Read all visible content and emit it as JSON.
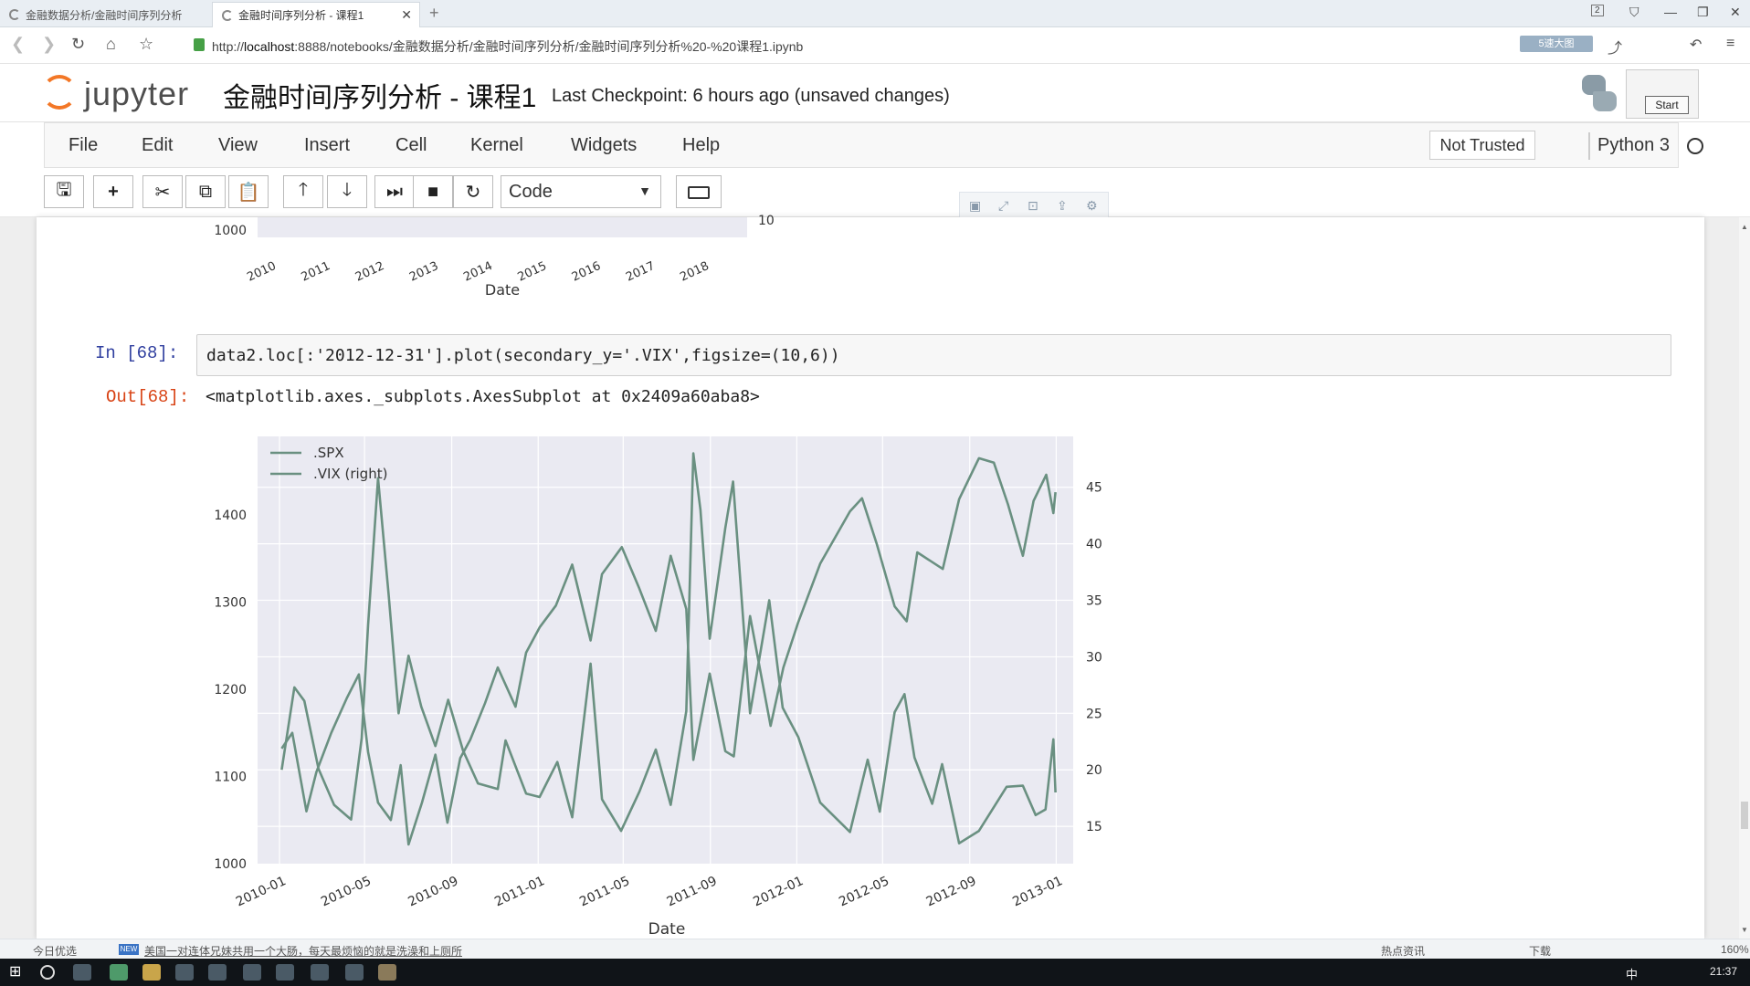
{
  "browser": {
    "tabs": [
      {
        "title": "金融数据分析/金融时间序列分析"
      },
      {
        "title": "金融时间序列分析 - 课程1"
      }
    ],
    "url_scheme": "http://",
    "url_host": "localhost",
    "url_rest": ":8888/notebooks/金融数据分析/金融时间序列分析/金融时间序列分析%20-%20课程1.ipynb",
    "tab_badge": "2",
    "zoom_badge": "5速大图"
  },
  "jupyter": {
    "logo_text": "jupyter",
    "notebook_title": "金融时间序列分析 - 课程1",
    "checkpoint": "Last Checkpoint: 6 hours ago (unsaved changes)",
    "start_button": "Start",
    "menu": [
      "File",
      "Edit",
      "View",
      "Insert",
      "Cell",
      "Kernel",
      "Widgets",
      "Help"
    ],
    "trust": "Not Trusted",
    "kernel": "Python 3",
    "cell_type": "Code"
  },
  "cells": {
    "in_prompt": "In  [68]:",
    "code": "data2.loc[:'2012-12-31'].plot(secondary_y='.VIX',figsize=(10,6))",
    "out_prompt": "Out[68]:",
    "out_text": "<matplotlib.axes._subplots.AxesSubplot at 0x2409a60aba8>"
  },
  "prev_chart": {
    "x_ticks": [
      "2010",
      "2011",
      "2012",
      "2013",
      "2014",
      "2015",
      "2016",
      "2017",
      "2018"
    ],
    "y_tick": "1000",
    "right_tick": "10",
    "xlabel": "Date"
  },
  "chart_data": {
    "type": "line",
    "xlabel": "Date",
    "ylabel": "",
    "x_range": [
      "2009-12-01",
      "2013-01-25"
    ],
    "x_ticks": [
      "2010-01",
      "2010-05",
      "2010-09",
      "2011-01",
      "2011-05",
      "2011-09",
      "2012-01",
      "2012-05",
      "2012-09",
      "2013-01"
    ],
    "ylim_left": [
      1000,
      1490
    ],
    "yticks_left": [
      1000,
      1100,
      1200,
      1300,
      1400
    ],
    "ylim_right": [
      11.7,
      49.5
    ],
    "yticks_right": [
      15,
      20,
      25,
      30,
      35,
      40,
      45
    ],
    "legend_position": "top-left",
    "grid": true,
    "line_color": "#6a9081",
    "series": [
      {
        "name": ".SPX",
        "axis": "left",
        "points": [
          [
            "2010-01-04",
            1132
          ],
          [
            "2010-01-19",
            1150
          ],
          [
            "2010-02-08",
            1060
          ],
          [
            "2010-02-22",
            1105
          ],
          [
            "2010-03-15",
            1150
          ],
          [
            "2010-04-06",
            1190
          ],
          [
            "2010-04-23",
            1217
          ],
          [
            "2010-05-06",
            1128
          ],
          [
            "2010-05-20",
            1070
          ],
          [
            "2010-06-07",
            1050
          ],
          [
            "2010-06-21",
            1113
          ],
          [
            "2010-07-02",
            1022
          ],
          [
            "2010-07-21",
            1070
          ],
          [
            "2010-08-09",
            1125
          ],
          [
            "2010-08-26",
            1047
          ],
          [
            "2010-09-13",
            1121
          ],
          [
            "2010-09-27",
            1142
          ],
          [
            "2010-10-18",
            1184
          ],
          [
            "2010-11-05",
            1225
          ],
          [
            "2010-11-30",
            1180
          ],
          [
            "2010-12-15",
            1242
          ],
          [
            "2011-01-03",
            1271
          ],
          [
            "2011-01-26",
            1296
          ],
          [
            "2011-02-18",
            1343
          ],
          [
            "2011-03-16",
            1256
          ],
          [
            "2011-04-01",
            1332
          ],
          [
            "2011-04-29",
            1363
          ],
          [
            "2011-05-23",
            1317
          ],
          [
            "2011-06-16",
            1267
          ],
          [
            "2011-07-07",
            1353
          ],
          [
            "2011-07-29",
            1292
          ],
          [
            "2011-08-08",
            1119
          ],
          [
            "2011-08-31",
            1218
          ],
          [
            "2011-09-22",
            1129
          ],
          [
            "2011-10-04",
            1123
          ],
          [
            "2011-10-27",
            1284
          ],
          [
            "2011-11-25",
            1158
          ],
          [
            "2011-12-13",
            1225
          ],
          [
            "2012-01-03",
            1277
          ],
          [
            "2012-02-03",
            1344
          ],
          [
            "2012-03-16",
            1404
          ],
          [
            "2012-04-02",
            1419
          ],
          [
            "2012-04-23",
            1366
          ],
          [
            "2012-05-18",
            1295
          ],
          [
            "2012-06-04",
            1278
          ],
          [
            "2012-06-19",
            1357
          ],
          [
            "2012-07-25",
            1338
          ],
          [
            "2012-08-17",
            1418
          ],
          [
            "2012-09-14",
            1465
          ],
          [
            "2012-10-05",
            1460
          ],
          [
            "2012-10-25",
            1412
          ],
          [
            "2012-11-15",
            1353
          ],
          [
            "2012-11-30",
            1416
          ],
          [
            "2012-12-18",
            1446
          ],
          [
            "2012-12-28",
            1402
          ],
          [
            "2012-12-31",
            1426
          ]
        ]
      },
      {
        "name": ".VIX (right)",
        "axis": "right",
        "points": [
          [
            "2010-01-04",
            20.0
          ],
          [
            "2010-01-22",
            27.3
          ],
          [
            "2010-02-05",
            26.1
          ],
          [
            "2010-02-25",
            20.1
          ],
          [
            "2010-03-19",
            16.9
          ],
          [
            "2010-04-12",
            15.6
          ],
          [
            "2010-04-27",
            22.8
          ],
          [
            "2010-05-06",
            32.8
          ],
          [
            "2010-05-20",
            45.8
          ],
          [
            "2010-06-04",
            35.5
          ],
          [
            "2010-06-18",
            25.0
          ],
          [
            "2010-07-02",
            30.1
          ],
          [
            "2010-07-20",
            25.6
          ],
          [
            "2010-08-09",
            22.1
          ],
          [
            "2010-08-27",
            26.2
          ],
          [
            "2010-09-17",
            21.7
          ],
          [
            "2010-10-08",
            18.8
          ],
          [
            "2010-11-05",
            18.3
          ],
          [
            "2010-11-16",
            22.6
          ],
          [
            "2010-12-15",
            17.9
          ],
          [
            "2011-01-03",
            17.6
          ],
          [
            "2011-01-28",
            20.7
          ],
          [
            "2011-02-18",
            15.8
          ],
          [
            "2011-03-16",
            29.4
          ],
          [
            "2011-04-01",
            17.4
          ],
          [
            "2011-04-28",
            14.6
          ],
          [
            "2011-05-24",
            18.1
          ],
          [
            "2011-06-16",
            21.8
          ],
          [
            "2011-07-07",
            16.9
          ],
          [
            "2011-07-29",
            25.2
          ],
          [
            "2011-08-08",
            48.0
          ],
          [
            "2011-08-18",
            43.0
          ],
          [
            "2011-08-31",
            31.6
          ],
          [
            "2011-09-22",
            41.4
          ],
          [
            "2011-10-03",
            45.5
          ],
          [
            "2011-10-27",
            25.0
          ],
          [
            "2011-11-23",
            35.0
          ],
          [
            "2011-12-12",
            25.5
          ],
          [
            "2012-01-03",
            22.9
          ],
          [
            "2012-02-03",
            17.1
          ],
          [
            "2012-03-16",
            14.5
          ],
          [
            "2012-04-10",
            20.9
          ],
          [
            "2012-04-27",
            16.3
          ],
          [
            "2012-05-18",
            25.1
          ],
          [
            "2012-06-01",
            26.7
          ],
          [
            "2012-06-15",
            21.1
          ],
          [
            "2012-07-10",
            17.0
          ],
          [
            "2012-07-24",
            20.5
          ],
          [
            "2012-08-17",
            13.5
          ],
          [
            "2012-09-14",
            14.6
          ],
          [
            "2012-10-23",
            18.5
          ],
          [
            "2012-11-15",
            18.6
          ],
          [
            "2012-12-03",
            16.0
          ],
          [
            "2012-12-17",
            16.5
          ],
          [
            "2012-12-28",
            22.7
          ],
          [
            "2012-12-31",
            18.0
          ]
        ]
      }
    ]
  },
  "statusbar": {
    "left_label": "今日优选",
    "news_badge": "NEW",
    "news": "美国一对连体兄妹共用一个大肠，每天最烦恼的就是洗澡和上厕所",
    "hot": "热点资讯",
    "download": "下载",
    "zoom": "160%"
  },
  "taskbar": {
    "time": "21:37",
    "ime": "中"
  }
}
